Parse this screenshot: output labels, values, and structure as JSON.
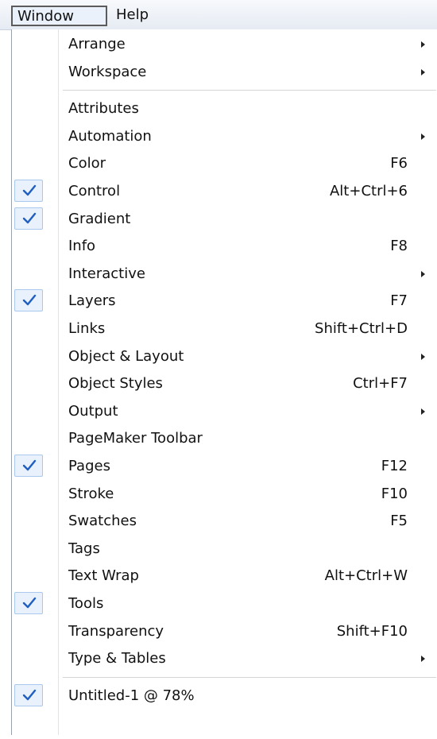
{
  "menubar": {
    "window_label": "Window",
    "help_label": "Help"
  },
  "menu": {
    "groups": [
      [
        {
          "label": "Arrange",
          "shortcut": "",
          "submenu": true,
          "checked": false
        },
        {
          "label": "Workspace",
          "shortcut": "",
          "submenu": true,
          "checked": false
        }
      ],
      [
        {
          "label": "Attributes",
          "shortcut": "",
          "submenu": false,
          "checked": false
        },
        {
          "label": "Automation",
          "shortcut": "",
          "submenu": true,
          "checked": false
        },
        {
          "label": "Color",
          "shortcut": "F6",
          "submenu": false,
          "checked": false
        },
        {
          "label": "Control",
          "shortcut": "Alt+Ctrl+6",
          "submenu": false,
          "checked": true
        },
        {
          "label": "Gradient",
          "shortcut": "",
          "submenu": false,
          "checked": true
        },
        {
          "label": "Info",
          "shortcut": "F8",
          "submenu": false,
          "checked": false
        },
        {
          "label": "Interactive",
          "shortcut": "",
          "submenu": true,
          "checked": false
        },
        {
          "label": "Layers",
          "shortcut": "F7",
          "submenu": false,
          "checked": true
        },
        {
          "label": "Links",
          "shortcut": "Shift+Ctrl+D",
          "submenu": false,
          "checked": false
        },
        {
          "label": "Object & Layout",
          "shortcut": "",
          "submenu": true,
          "checked": false
        },
        {
          "label": "Object Styles",
          "shortcut": "Ctrl+F7",
          "submenu": false,
          "checked": false
        },
        {
          "label": "Output",
          "shortcut": "",
          "submenu": true,
          "checked": false
        },
        {
          "label": "PageMaker Toolbar",
          "shortcut": "",
          "submenu": false,
          "checked": false
        },
        {
          "label": "Pages",
          "shortcut": "F12",
          "submenu": false,
          "checked": true
        },
        {
          "label": "Stroke",
          "shortcut": "F10",
          "submenu": false,
          "checked": false
        },
        {
          "label": "Swatches",
          "shortcut": "F5",
          "submenu": false,
          "checked": false
        },
        {
          "label": "Tags",
          "shortcut": "",
          "submenu": false,
          "checked": false
        },
        {
          "label": "Text Wrap",
          "shortcut": "Alt+Ctrl+W",
          "submenu": false,
          "checked": false
        },
        {
          "label": "Tools",
          "shortcut": "",
          "submenu": false,
          "checked": true
        },
        {
          "label": "Transparency",
          "shortcut": "Shift+F10",
          "submenu": false,
          "checked": false
        },
        {
          "label": "Type & Tables",
          "shortcut": "",
          "submenu": true,
          "checked": false
        }
      ],
      [
        {
          "label": "Untitled-1 @ 78%",
          "shortcut": "",
          "submenu": false,
          "checked": true
        }
      ]
    ]
  },
  "colors": {
    "check_mark": "#1f5fbf",
    "check_bg": "#e8f1fc"
  }
}
